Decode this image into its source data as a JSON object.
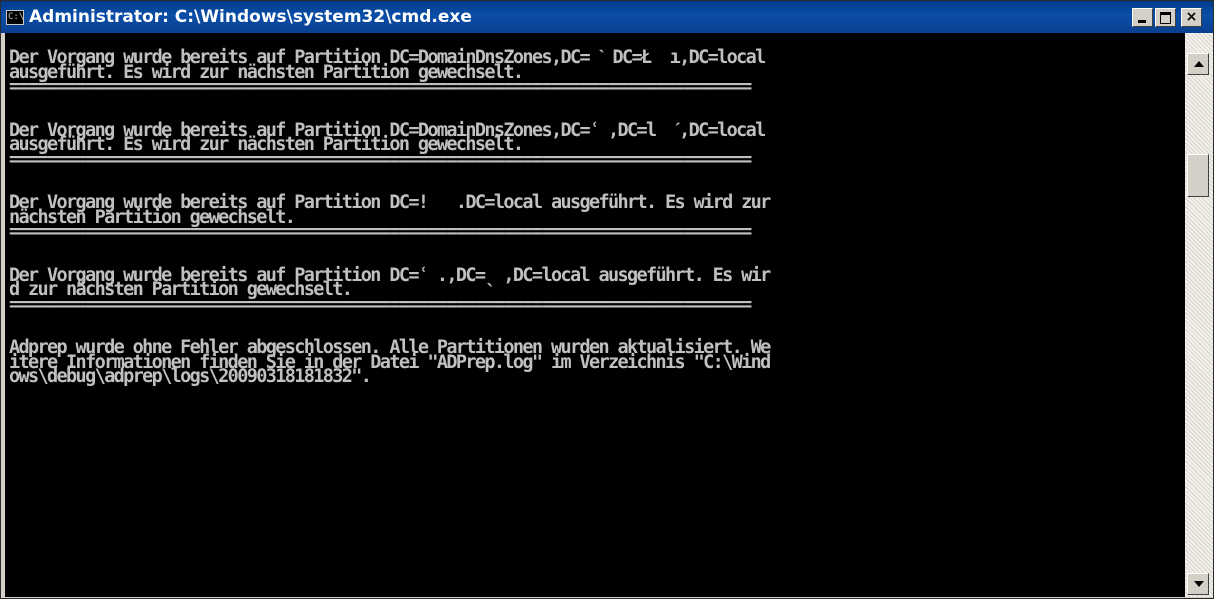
{
  "window": {
    "title": "Administrator: C:\\Windows\\system32\\cmd.exe",
    "icon_text": "C:\\",
    "buttons": {
      "minimize": "minimize-icon",
      "maximize": "maximize-icon",
      "close": "×"
    }
  },
  "console": {
    "lines": [
      "Der Vorgang wurde bereits auf Partition DC=DomainDnsZones,DC= ˋ DC=Ł  ı,DC=local",
      "ausgeführt. Es wird zur nächsten Partition gewechselt.",
      "==============================================================================",
      "",
      "",
      "Der Vorgang wurde bereits auf Partition DC=DomainDnsZones,DC=ʿ ,DC=l  ˊ,DC=local",
      "ausgeführt. Es wird zur nächsten Partition gewechselt.",
      "==============================================================================",
      "",
      "",
      "Der Vorgang wurde bereits auf Partition DC=!   .DC=local ausgeführt. Es wird zur",
      "nächsten Partition gewechselt.",
      "==============================================================================",
      "",
      "",
      "Der Vorgang wurde bereits auf Partition DC=ʿ .,DC=ˎ ,DC=local ausgeführt. Es wir",
      "d zur nächsten Partition gewechselt.",
      "==============================================================================",
      "",
      "",
      "Adprep wurde ohne Fehler abgeschlossen. Alle Partitionen wurden aktualisiert. We",
      "itere Informationen finden Sie in der Datei \"ADPrep.log\" im Verzeichnis \"C:\\Wind",
      "ows\\debug\\adprep\\logs\\20090318181832\".",
      "",
      ""
    ]
  },
  "scrollbar": {
    "position": 0.18
  },
  "colors": {
    "console_bg": "#000000",
    "console_fg": "#c0c0c0",
    "titlebar": "#0a4ea8"
  }
}
